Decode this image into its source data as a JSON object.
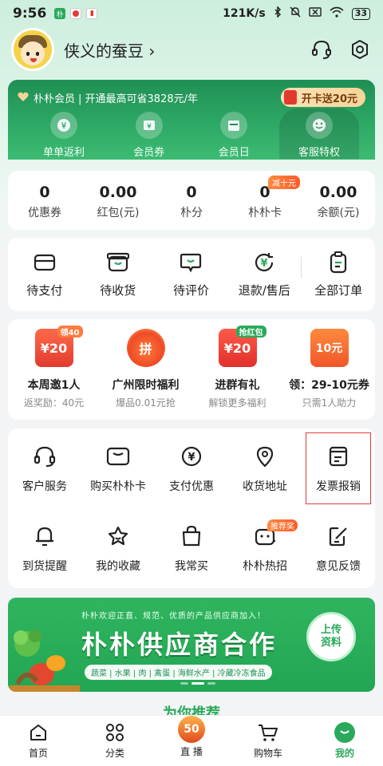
{
  "status_bar": {
    "time": "9:56",
    "speed": "121K/s",
    "battery": "33"
  },
  "profile": {
    "nickname": "侠义的蚕豆",
    "chevron": "›"
  },
  "member": {
    "title": "朴朴会员",
    "subtitle": "| 开通最高可省3828元/年",
    "cta": "开卡送20元",
    "benefits": [
      {
        "label": "单单返利",
        "icon": "yuan-coin-icon"
      },
      {
        "label": "会员券",
        "icon": "coupon-icon"
      },
      {
        "label": "会员日",
        "icon": "calendar-icon"
      },
      {
        "label": "客服特权",
        "icon": "smile-icon"
      }
    ]
  },
  "stats": [
    {
      "value": "0",
      "label": "优惠券"
    },
    {
      "value": "0.00",
      "label": "红包(元)"
    },
    {
      "value": "0",
      "label": "朴分"
    },
    {
      "value": "0",
      "label": "朴朴卡",
      "badge": "减十元"
    },
    {
      "value": "0.00",
      "label": "余额(元)"
    }
  ],
  "orders": [
    {
      "label": "待支付"
    },
    {
      "label": "待收货"
    },
    {
      "label": "待评价"
    },
    {
      "label": "退款/售后"
    },
    {
      "label": "全部订单"
    }
  ],
  "promos": [
    {
      "title": "本周邀1人",
      "sub": "返奖励：40元",
      "img_text": "¥20",
      "tag": "领40"
    },
    {
      "title": "广州限时福利",
      "sub": "爆品0.01元抢",
      "img_text": "拼",
      "tag": ""
    },
    {
      "title": "进群有礼",
      "sub": "解锁更多福利",
      "img_text": "¥20",
      "tag": "抢红包"
    },
    {
      "title": "领：29-10元券",
      "sub": "只需1人助力",
      "img_text": "10元",
      "tag": ""
    }
  ],
  "services_row1": [
    {
      "label": "客户服务"
    },
    {
      "label": "购买朴朴卡"
    },
    {
      "label": "支付优惠"
    },
    {
      "label": "收货地址"
    },
    {
      "label": "发票报销"
    }
  ],
  "services_row2": [
    {
      "label": "到货提醒"
    },
    {
      "label": "我的收藏"
    },
    {
      "label": "我常买"
    },
    {
      "label": "朴朴热招",
      "badge": "推荐奖"
    },
    {
      "label": "意见反馈"
    }
  ],
  "banner": {
    "top_text": "朴朴欢迎正直、规范、优质的产品供应商加入！",
    "title": "朴朴供应商合作",
    "categories": "蔬菜 | 水果 | 肉 | 禽蛋 | 海鲜水产 | 冷藏冷冻食品",
    "cta_line1": "上传",
    "cta_line2": "资料"
  },
  "recommend_title": "为你推荐",
  "tabs": [
    {
      "label": "首页"
    },
    {
      "label": "分类"
    },
    {
      "label": "直 播",
      "badge": "50"
    },
    {
      "label": "购物车"
    },
    {
      "label": "我的"
    }
  ],
  "colors": {
    "brand_green": "#2aa95b",
    "member_green": "#1f8f54",
    "accent_orange": "#ff5a26",
    "highlight_red": "#e33a3a"
  }
}
